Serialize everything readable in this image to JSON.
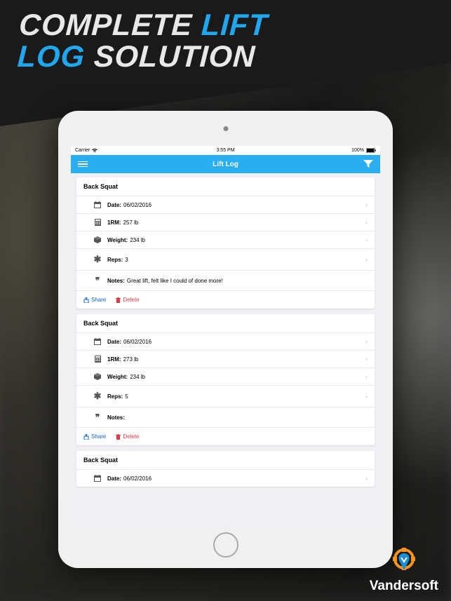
{
  "headline": {
    "w1": "COMPLETE",
    "w2": "LIFT",
    "w3": "LOG",
    "w4": "SOLUTION"
  },
  "statusbar": {
    "carrier": "Carrier",
    "time": "3:55 PM",
    "battery": "100%"
  },
  "nav": {
    "title": "Lift Log"
  },
  "labels": {
    "date": "Date:",
    "oneRM": "1RM:",
    "weight": "Weight:",
    "reps": "Reps:",
    "notes": "Notes:",
    "share": "Share",
    "delete": "Delete"
  },
  "entries": [
    {
      "title": "Back Squat",
      "date": "06/02/2016",
      "oneRM": "257 lb",
      "weight": "234 lb",
      "reps": "3",
      "notes": "Great lift, felt like I could of done more!"
    },
    {
      "title": "Back Squat",
      "date": "06/02/2016",
      "oneRM": "273 lb",
      "weight": "234 lb",
      "reps": "5",
      "notes": ""
    },
    {
      "title": "Back Squat",
      "date": "06/02/2016",
      "oneRM": "",
      "weight": "",
      "reps": "",
      "notes": ""
    }
  ],
  "brand": "Vandersoft"
}
